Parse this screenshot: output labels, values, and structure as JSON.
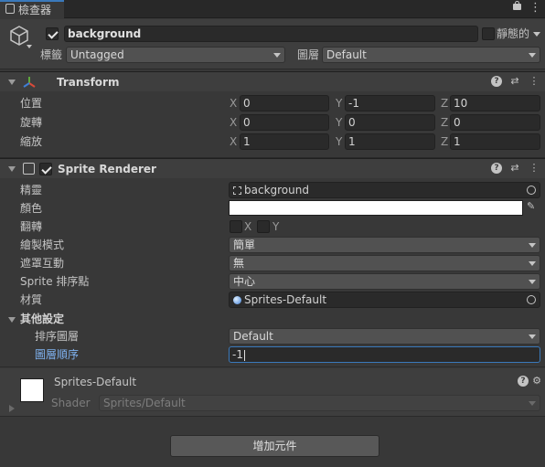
{
  "tab": {
    "label": "檢查器"
  },
  "object": {
    "active": true,
    "name": "background",
    "static_label": "靜態的",
    "tag_label": "標籤",
    "tag_value": "Untagged",
    "layer_label": "圖層",
    "layer_value": "Default"
  },
  "transform": {
    "title": "Transform",
    "rows": [
      {
        "label": "位置",
        "x": "0",
        "y": "-1",
        "z": "10"
      },
      {
        "label": "旋轉",
        "x": "0",
        "y": "0",
        "z": "0"
      },
      {
        "label": "縮放",
        "x": "1",
        "y": "1",
        "z": "1"
      }
    ],
    "axes": [
      "X",
      "Y",
      "Z"
    ]
  },
  "sprite_renderer": {
    "enabled": true,
    "title": "Sprite Renderer",
    "sprite_label": "精靈",
    "sprite_value": "background",
    "color_label": "顏色",
    "color_value": "#ffffff",
    "flip_label": "翻轉",
    "flip_x": "X",
    "flip_y": "Y",
    "draw_mode_label": "繪製模式",
    "draw_mode_value": "簡單",
    "mask_label": "遮罩互動",
    "mask_value": "無",
    "sort_point_label": "Sprite 排序點",
    "sort_point_value": "中心",
    "material_label": "材質",
    "material_value": "Sprites-Default",
    "additional_label": "其他設定",
    "sorting_layer_label": "排序圖層",
    "sorting_layer_value": "Default",
    "order_label": "圖層順序",
    "order_value": "-1"
  },
  "material": {
    "name": "Sprites-Default",
    "shader_label": "Shader",
    "shader_value": "Sprites/Default"
  },
  "add_component": {
    "label": "增加元件"
  }
}
